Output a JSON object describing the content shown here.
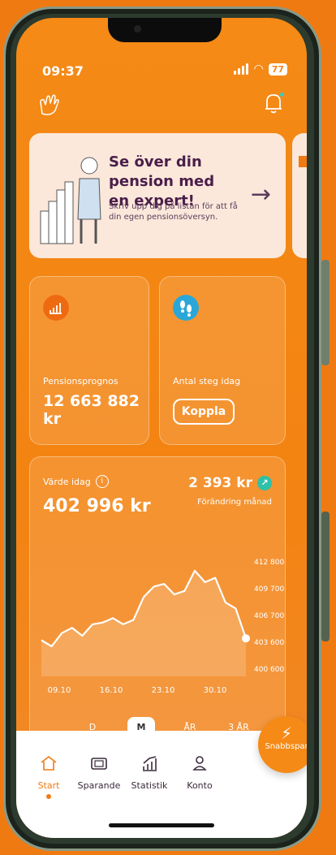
{
  "status": {
    "time": "09:37",
    "battery": "77"
  },
  "banner": {
    "title": "Se över din pension med en expert!",
    "text": "Skriv upp dig på listan för att få din egen pensionsöversyn."
  },
  "cards": {
    "forecast_label": "Pensionsprognos",
    "forecast_value": "12 663 882 kr",
    "steps_label": "Antal steg idag",
    "steps_button": "Koppla"
  },
  "value_card": {
    "label": "Värde idag",
    "value": "402 996 kr",
    "change_value": "2 393 kr",
    "change_label": "Förändring månad"
  },
  "chart_data": {
    "type": "area",
    "x_labels": [
      "09.10",
      "16.10",
      "23.10",
      "30.10"
    ],
    "y_ticks": [
      "412 800",
      "409 700",
      "406 700",
      "403 600",
      "400 600"
    ],
    "ylim": [
      400600,
      412800
    ],
    "series": [
      {
        "values": [
          403800,
          403100,
          404600,
          405200,
          404300,
          405600,
          405800,
          406300,
          405600,
          406100,
          408700,
          409900,
          410200,
          409000,
          409400,
          411700,
          410400,
          410900,
          408100,
          407400,
          404000
        ]
      }
    ]
  },
  "periods": [
    "D",
    "M",
    "ÅR",
    "3 ÅR"
  ],
  "active_period": "M",
  "tabs": [
    {
      "label": "Start",
      "icon": "home-icon"
    },
    {
      "label": "Sparande",
      "icon": "wallet-icon"
    },
    {
      "label": "Statistik",
      "icon": "statistics-icon"
    },
    {
      "label": "Konto",
      "icon": "user-icon"
    }
  ],
  "fab": {
    "label": "Snabbspar",
    "icon": "bolt-icon"
  },
  "colors": {
    "accent": "#f58a16",
    "teal": "#2fc0a8",
    "purple": "#4a1e4a"
  }
}
